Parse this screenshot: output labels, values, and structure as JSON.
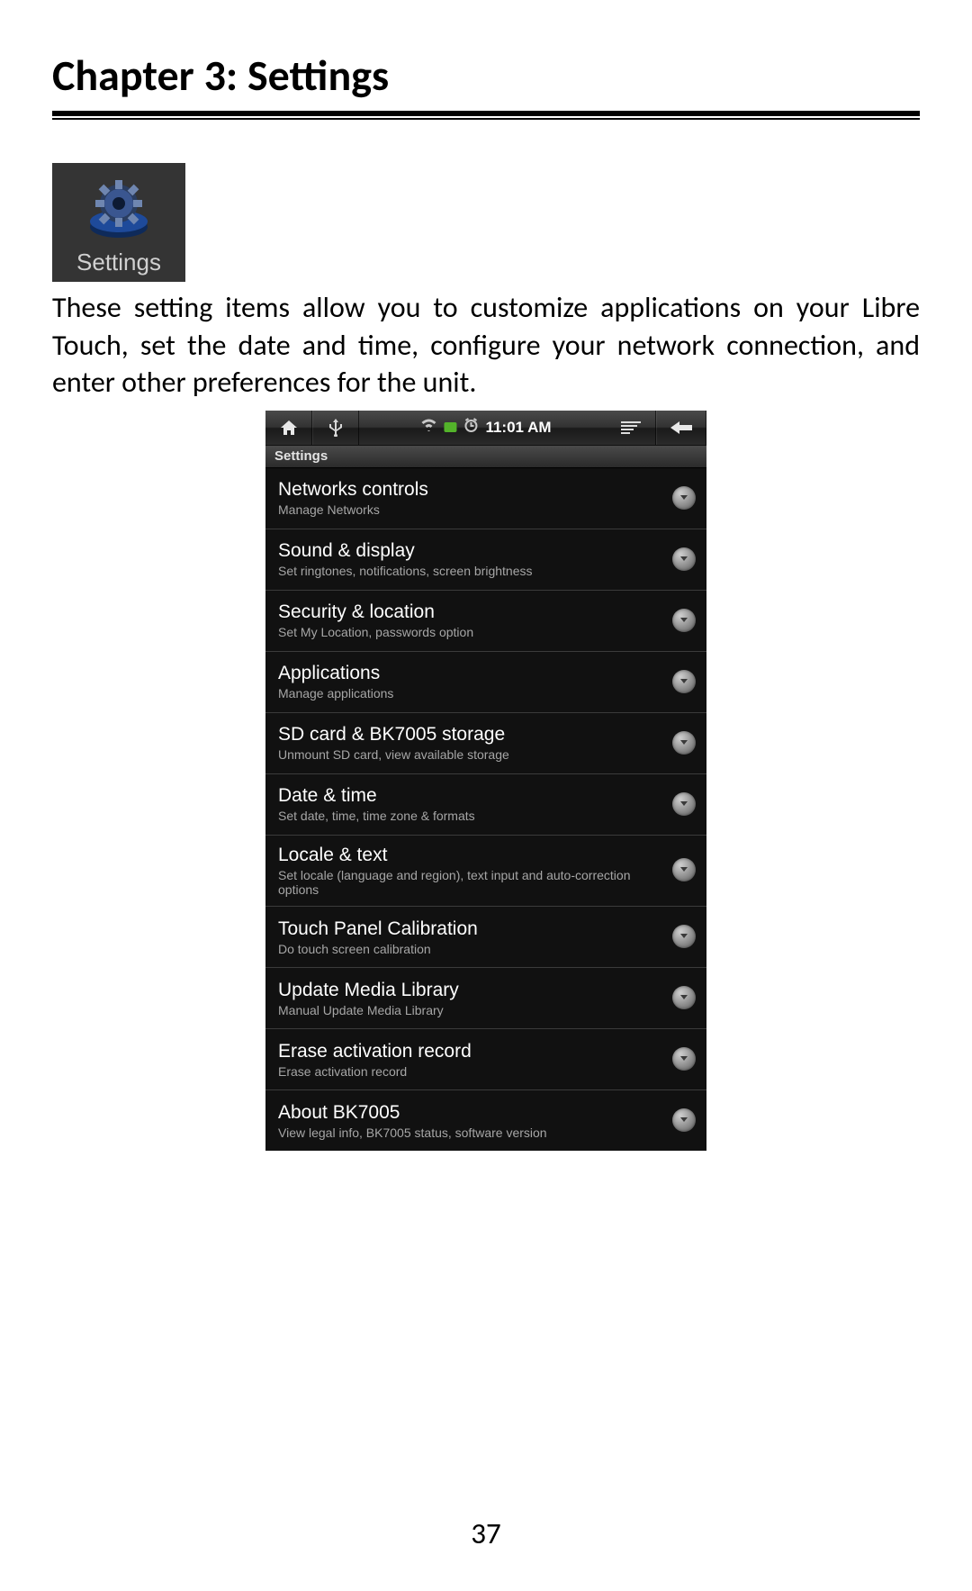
{
  "chapter_title": "Chapter 3: Settings",
  "settings_icon_label": "Settings",
  "intro_text": "These setting items allow you to customize applications on your Libre Touch, set the date and time, configure your network connection, and enter other preferences for the unit.",
  "page_number": "37",
  "phone": {
    "statusbar_time": "11:01 AM",
    "header_label": "Settings",
    "items": [
      {
        "title": "Networks controls",
        "sub": "Manage Networks"
      },
      {
        "title": "Sound & display",
        "sub": "Set ringtones, notifications, screen brightness"
      },
      {
        "title": "Security & location",
        "sub": "Set My Location, passwords option"
      },
      {
        "title": "Applications",
        "sub": "Manage applications"
      },
      {
        "title": "SD card & BK7005 storage",
        "sub": "Unmount SD card, view available storage"
      },
      {
        "title": "Date & time",
        "sub": "Set date, time, time zone & formats"
      },
      {
        "title": "Locale & text",
        "sub": "Set locale (language and region), text input and auto-correction options"
      },
      {
        "title": "Touch Panel Calibration",
        "sub": "Do touch screen calibration"
      },
      {
        "title": "Update Media Library",
        "sub": "Manual Update Media Library"
      },
      {
        "title": "Erase activation record",
        "sub": "Erase activation record"
      },
      {
        "title": "About BK7005",
        "sub": "View legal info, BK7005 status, software version"
      }
    ]
  }
}
